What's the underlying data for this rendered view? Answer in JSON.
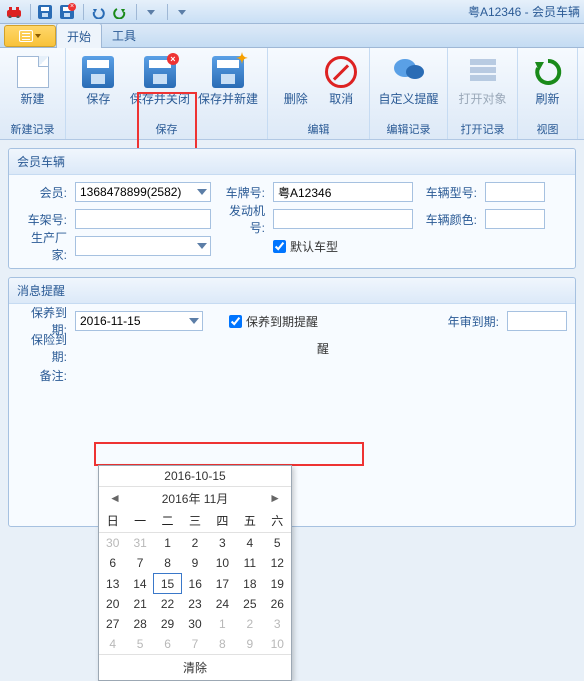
{
  "window": {
    "title": "粤A12346 - 会员车辆"
  },
  "menu": {
    "start": "开始",
    "tools": "工具"
  },
  "ribbon": {
    "new": "新建",
    "new_group": "新建记录",
    "save": "保存",
    "save_close": "保存并关闭",
    "save_new": "保存并新建",
    "save_group": "保存",
    "delete": "删除",
    "cancel": "取消",
    "edit_group": "编辑",
    "remind": "自定义提醒",
    "remind_group": "编辑记录",
    "open": "打开对象",
    "open_group": "打开记录",
    "refresh": "刷新",
    "view_group": "视图"
  },
  "panel1": {
    "title": "会员车辆",
    "member_label": "会员:",
    "member_value": "1368478899(2582)",
    "plate_label": "车牌号:",
    "plate_value": "粤A12346",
    "model_label": "车辆型号:",
    "model_value": "",
    "vin_label": "车架号:",
    "vin_value": "",
    "engine_label": "发动机号:",
    "engine_value": "",
    "color_label": "车辆颜色:",
    "color_value": "",
    "maker_label": "生产厂家:",
    "maker_value": "",
    "default_type": "默认车型"
  },
  "panel2": {
    "title": "消息提醒",
    "maint_date_label": "保养到期:",
    "maint_date_value": "2016-11-15",
    "maint_remind": "保养到期提醒",
    "annual_label": "年审到期:",
    "annual_value": "",
    "ins_label": "保险到期:",
    "ins_remind_tail": "醒",
    "note_label": "备注:"
  },
  "datepicker": {
    "top_date": "2016-10-15",
    "month_title": "2016年 11月",
    "dow": [
      "日",
      "一",
      "二",
      "三",
      "四",
      "五",
      "六"
    ],
    "weeks": [
      [
        {
          "d": 30,
          "dim": true
        },
        {
          "d": 31,
          "dim": true
        },
        {
          "d": 1
        },
        {
          "d": 2
        },
        {
          "d": 3
        },
        {
          "d": 4
        },
        {
          "d": 5
        }
      ],
      [
        {
          "d": 6
        },
        {
          "d": 7
        },
        {
          "d": 8
        },
        {
          "d": 9
        },
        {
          "d": 10
        },
        {
          "d": 11
        },
        {
          "d": 12
        }
      ],
      [
        {
          "d": 13
        },
        {
          "d": 14
        },
        {
          "d": 15,
          "sel": true
        },
        {
          "d": 16
        },
        {
          "d": 17
        },
        {
          "d": 18
        },
        {
          "d": 19
        }
      ],
      [
        {
          "d": 20
        },
        {
          "d": 21
        },
        {
          "d": 22
        },
        {
          "d": 23
        },
        {
          "d": 24
        },
        {
          "d": 25
        },
        {
          "d": 26
        }
      ],
      [
        {
          "d": 27
        },
        {
          "d": 28
        },
        {
          "d": 29
        },
        {
          "d": 30
        },
        {
          "d": 1,
          "dim": true
        },
        {
          "d": 2,
          "dim": true
        },
        {
          "d": 3,
          "dim": true
        }
      ],
      [
        {
          "d": 4,
          "dim": true
        },
        {
          "d": 5,
          "dim": true
        },
        {
          "d": 6,
          "dim": true
        },
        {
          "d": 7,
          "dim": true
        },
        {
          "d": 8,
          "dim": true
        },
        {
          "d": 9,
          "dim": true
        },
        {
          "d": 10,
          "dim": true
        }
      ]
    ],
    "clear": "清除"
  }
}
